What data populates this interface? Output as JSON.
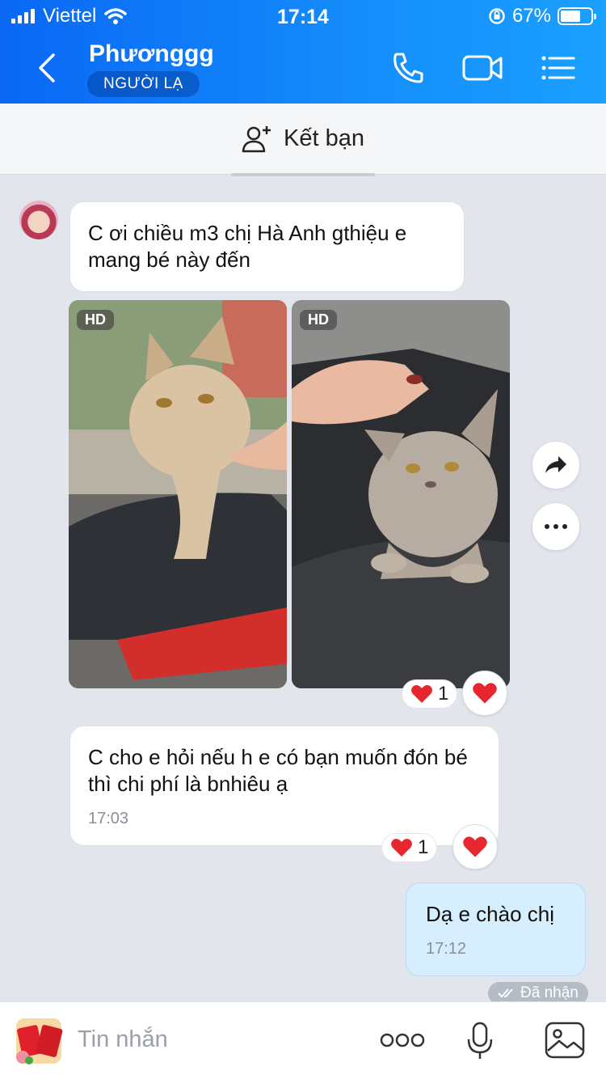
{
  "status_bar": {
    "carrier": "Viettel",
    "time": "17:14",
    "battery": "67%",
    "battery_level": 0.67
  },
  "header": {
    "contact_name": "Phươnggg",
    "badge": "NGƯỜI LẠ",
    "icons": [
      "back-icon",
      "phone-icon",
      "video-call-icon",
      "menu-list-icon"
    ]
  },
  "friend_bar": {
    "label": "Kết bạn",
    "icon": "add-friend-icon"
  },
  "messages": [
    {
      "sender": "contact",
      "text": "C ơi chiều m3 chị Hà Anh gthiệu e mang bé này đến"
    },
    {
      "sender": "contact",
      "type": "photos",
      "badges": [
        "HD",
        "HD"
      ],
      "reaction_count": "1"
    },
    {
      "sender": "contact",
      "text": "C cho e hỏi nếu h e có bạn muốn đón bé thì chi phí là bnhiêu ạ",
      "time": "17:03",
      "reaction_count": "1"
    },
    {
      "sender": "me",
      "text": "Dạ e chào chị",
      "time": "17:12",
      "status": "Đã nhận"
    }
  ],
  "input": {
    "placeholder": "Tin nhắn",
    "icons": [
      "sticker-icon",
      "more-icon",
      "microphone-icon",
      "image-icon"
    ]
  },
  "colors": {
    "header_start": "#0a68f5",
    "header_end": "#1aa0ff",
    "my_bubble": "#d7eefe",
    "heart": "#e8262d"
  }
}
